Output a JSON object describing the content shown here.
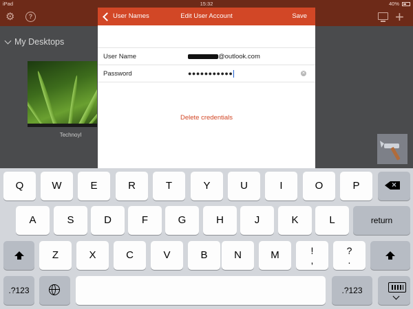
{
  "status_bar": {
    "device": "iPad",
    "time": "15:32",
    "battery": "40%"
  },
  "background_app": {
    "section_title": "My Desktops",
    "desktop": {
      "name": "Technoyl"
    }
  },
  "dialog": {
    "back_label": "User Names",
    "title": "Edit User Account",
    "save_label": "Save",
    "fields": {
      "username_label": "User Name",
      "username_value_visible": "@outlook.com",
      "password_label": "Password",
      "password_mask": "●●●●●●●●●●●"
    },
    "delete_label": "Delete credentials"
  },
  "keyboard": {
    "row1": [
      "Q",
      "W",
      "E",
      "R",
      "T",
      "Y",
      "U",
      "I",
      "O",
      "P"
    ],
    "row2": [
      "A",
      "S",
      "D",
      "F",
      "G",
      "H",
      "J",
      "K",
      "L"
    ],
    "row3": [
      "Z",
      "X",
      "C",
      "V",
      "B",
      "N",
      "M"
    ],
    "punct1": [
      "!",
      ","
    ],
    "punct2": [
      "?",
      "."
    ],
    "return_label": "return",
    "numbers_label": ".?123",
    "accent": "#d24726"
  }
}
